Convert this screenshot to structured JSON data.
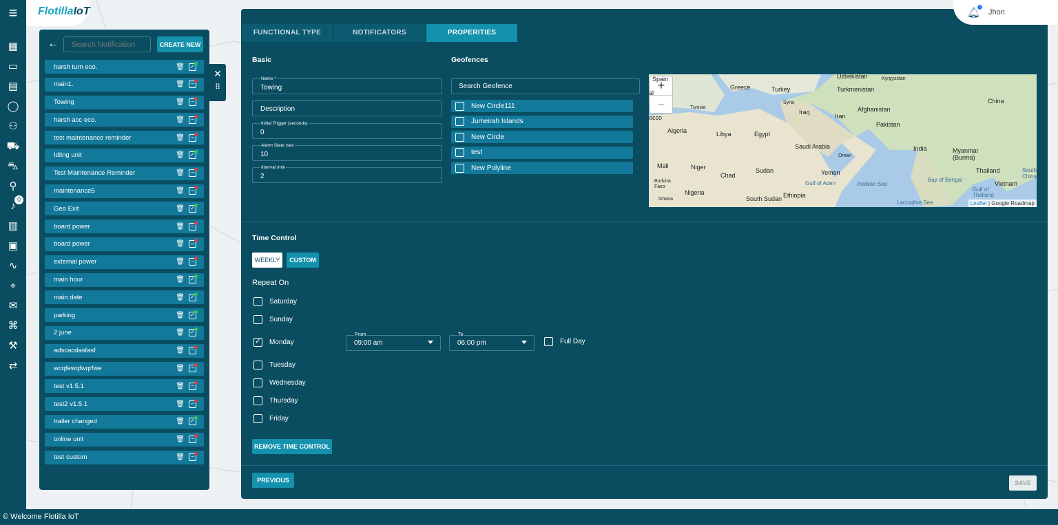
{
  "app": {
    "logo_main": "Flotilla",
    "logo_accent": "IoT",
    "user": "Jhon",
    "notification_count": "0",
    "footer": "© Welcome Flotilla IoT"
  },
  "list": {
    "search_placeholder": "Search Notification",
    "create_label": "CREATE NEW",
    "items": [
      {
        "label": "harsh turn eco.",
        "status": "active"
      },
      {
        "label": "main1.",
        "status": "inactive"
      },
      {
        "label": "Towing",
        "status": "inactive"
      },
      {
        "label": "harsh acc eco.",
        "status": "inactive"
      },
      {
        "label": "test maintenance reminder",
        "status": "inactive"
      },
      {
        "label": "Idling unit",
        "status": "active"
      },
      {
        "label": "Test Maintenance Reminder",
        "status": "inactive"
      },
      {
        "label": "maintenance5",
        "status": "inactive"
      },
      {
        "label": "Geo Exit",
        "status": "active"
      },
      {
        "label": "board power",
        "status": "inactive"
      },
      {
        "label": "board power",
        "status": "inactive"
      },
      {
        "label": "external power",
        "status": "inactive"
      },
      {
        "label": "main hour",
        "status": "active"
      },
      {
        "label": "main date",
        "status": "active"
      },
      {
        "label": "parking",
        "status": "active"
      },
      {
        "label": "2 june",
        "status": "active"
      },
      {
        "label": "adscacdasfasf",
        "status": "inactive"
      },
      {
        "label": "wcqfewqfwqrfwe",
        "status": "inactive"
      },
      {
        "label": "test v1.5.1",
        "status": "inactive"
      },
      {
        "label": "test2 v1.5.1",
        "status": "inactive"
      },
      {
        "label": "trailer changed",
        "status": "active"
      },
      {
        "label": "online unit",
        "status": "inactive"
      },
      {
        "label": "test custom",
        "status": "inactive"
      }
    ]
  },
  "tabs": [
    "FUNCTIONAL TYPE",
    "NOTIFICATORS",
    "PROPERITIES"
  ],
  "basic": {
    "title": "Basic",
    "name_label": "Name *",
    "name_value": "Towing",
    "description_placeholder": "Description",
    "initial_label": "Initial Trigger (seconds)",
    "initial_value": "0",
    "alarm_label": "Alarm State /sec",
    "alarm_value": "10",
    "interval_label": "Interval /min",
    "interval_value": "2"
  },
  "geofences": {
    "title": "Geofences",
    "search_placeholder": "Search Geofence",
    "items": [
      "New Circle111",
      "Jumeirah Islands",
      "New Circle",
      "test",
      "New Polyline"
    ]
  },
  "map": {
    "zoom_in": "+",
    "zoom_out": "−",
    "attribution_link": "Leaflet",
    "attribution_rest": " | Google Roadmap",
    "labels": {
      "spain": "Spain",
      "al": "al",
      "greece": "Greece",
      "turkey": "Turkey",
      "uzbekistan": "Uzbekistan",
      "kyrgyzstan": "Kyrgyzstan",
      "turkmenistan": "Turkmenistan",
      "tunisia": "Tunisia",
      "syria": "Syria",
      "iraq": "Iraq",
      "afghanistan": "Afghanistan",
      "china": "China",
      "occo": "occo",
      "iran": "Iran",
      "pakistan": "Pakistan",
      "algeria": "Algeria",
      "libya": "Libya",
      "egypt": "Egypt",
      "saudi": "Saudi Arabia",
      "oman": "Oman",
      "india": "India",
      "myanmar": "Myanmar\n(Burma)",
      "mali": "Mali",
      "niger": "Niger",
      "sudan": "Sudan",
      "yemen": "Yemen",
      "chad": "Chad",
      "thailand": "Thailand",
      "south_china": "South\nChina S",
      "gulf_aden": "Gulf of Aden",
      "arabian": "Arabian Sea",
      "bengal": "Bay of Bengal",
      "vietnam": "Vietnam",
      "burkina": "Burkina\nFaso",
      "nigeria": "Nigeria",
      "south_sudan": "South Sudan",
      "ethiopia": "Ethiopia",
      "gulf_thailand": "Gulf of\nThailand",
      "ghana": "Ghana",
      "laccadive": "Laccadive Sea"
    }
  },
  "time": {
    "title": "Time Control",
    "weekly": "WEEKLY",
    "custom": "CUSTOM",
    "repeat_on": "Repeat On",
    "days": [
      {
        "name": "Saturday",
        "checked": false
      },
      {
        "name": "Sunday",
        "checked": false
      },
      {
        "name": "Monday",
        "checked": true
      },
      {
        "name": "Tuesday",
        "checked": false
      },
      {
        "name": "Wednesday",
        "checked": false
      },
      {
        "name": "Thursday",
        "checked": false
      },
      {
        "name": "Friday",
        "checked": false
      }
    ],
    "from_label": "From",
    "from_value": "09:00 am",
    "to_label": "To",
    "to_value": "06:00 pm",
    "full_day": "Full Day",
    "remove": "REMOVE TIME CONTROL"
  },
  "actions": {
    "previous": "PREVIOUS",
    "save": "SAVE"
  },
  "colors": {
    "panel": "#0a4d60",
    "accent": "#1391ad",
    "item": "#13799a",
    "active_dot": "#35c94a",
    "inactive_dot": "#e33b3b"
  }
}
